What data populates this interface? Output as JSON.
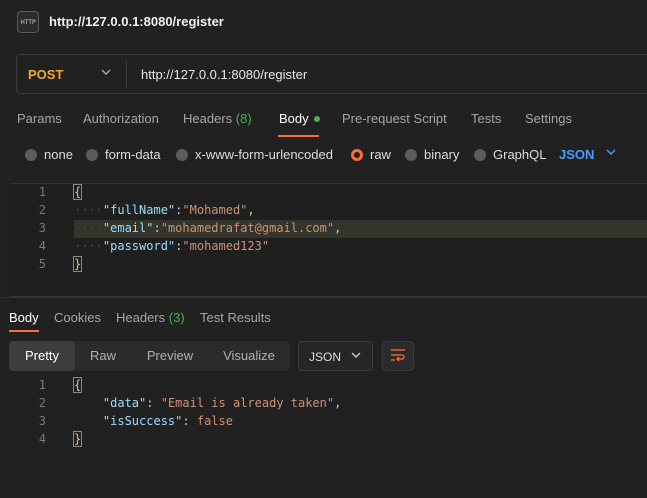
{
  "tab": {
    "title": "http://127.0.0.1:8080/register",
    "icon": "http-file-icon",
    "icon_text": "HTTP"
  },
  "request": {
    "method": "POST",
    "url": "http://127.0.0.1:8080/register",
    "tabs": [
      {
        "label": "Params"
      },
      {
        "label": "Authorization"
      },
      {
        "label": "Headers",
        "count": "(8)"
      },
      {
        "label": "Body"
      },
      {
        "label": "Pre-request Script"
      },
      {
        "label": "Tests"
      },
      {
        "label": "Settings"
      }
    ],
    "body_types": [
      "none",
      "form-data",
      "x-www-form-urlencoded",
      "raw",
      "binary",
      "GraphQL"
    ],
    "selected_body_type": "raw",
    "format": "JSON",
    "lines": {
      "n": [
        "1",
        "2",
        "3",
        "4",
        "5"
      ],
      "open": "{",
      "close": "}",
      "k1": "\"fullName\"",
      "v1": "\"Mohamed\"",
      "k2": "\"email\"",
      "v2": "\"mohamedrafat@gmail.com\"",
      "k3": "\"password\"",
      "v3": "\"mohamed123\""
    }
  },
  "response": {
    "tabs": [
      {
        "label": "Body"
      },
      {
        "label": "Cookies"
      },
      {
        "label": "Headers",
        "count": "(3)"
      },
      {
        "label": "Test Results"
      }
    ],
    "views": [
      "Pretty",
      "Raw",
      "Preview",
      "Visualize"
    ],
    "format": "JSON",
    "lines": {
      "n": [
        "1",
        "2",
        "3",
        "4"
      ],
      "open": "{",
      "close": "}",
      "k1": "\"data\"",
      "v1": "\"Email is already taken\"",
      "k2": "\"isSuccess\"",
      "v2": "false"
    }
  },
  "colors": {
    "accent": "#ff6c37",
    "method": "#f9a825",
    "count": "#4caf50",
    "link": "#4a9bff"
  }
}
